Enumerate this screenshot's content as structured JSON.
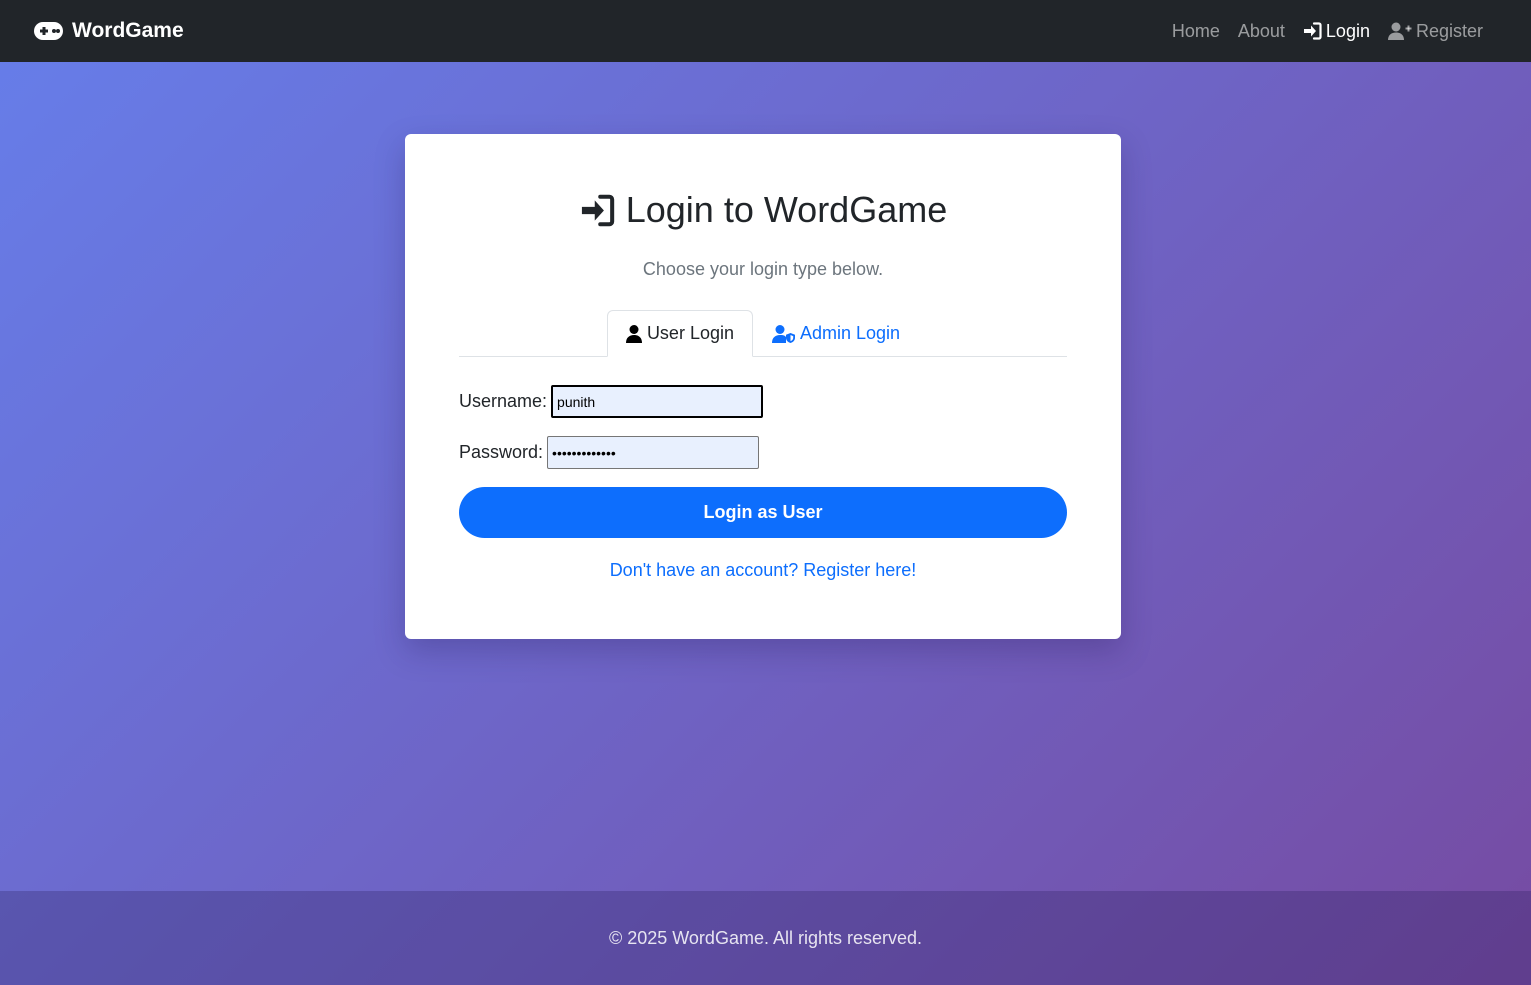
{
  "navbar": {
    "brand": "WordGame",
    "links": {
      "home": "Home",
      "about": "About",
      "login": "Login",
      "register": "Register"
    }
  },
  "card": {
    "title": "Login to WordGame",
    "subtitle": "Choose your login type below.",
    "tabs": {
      "user": "User Login",
      "admin": "Admin Login"
    },
    "form": {
      "username_label": "Username:",
      "username_value": "punith",
      "password_label": "Password:",
      "password_value": "•••••••••••••",
      "submit_label": "Login as User"
    },
    "register_link": "Don't have an account? Register here!"
  },
  "footer": {
    "text": "© 2025 WordGame. All rights reserved."
  },
  "colors": {
    "primary": "#0d6efd",
    "navbar_bg": "#212529",
    "gradient_start": "#667eea",
    "gradient_end": "#764ba2"
  }
}
